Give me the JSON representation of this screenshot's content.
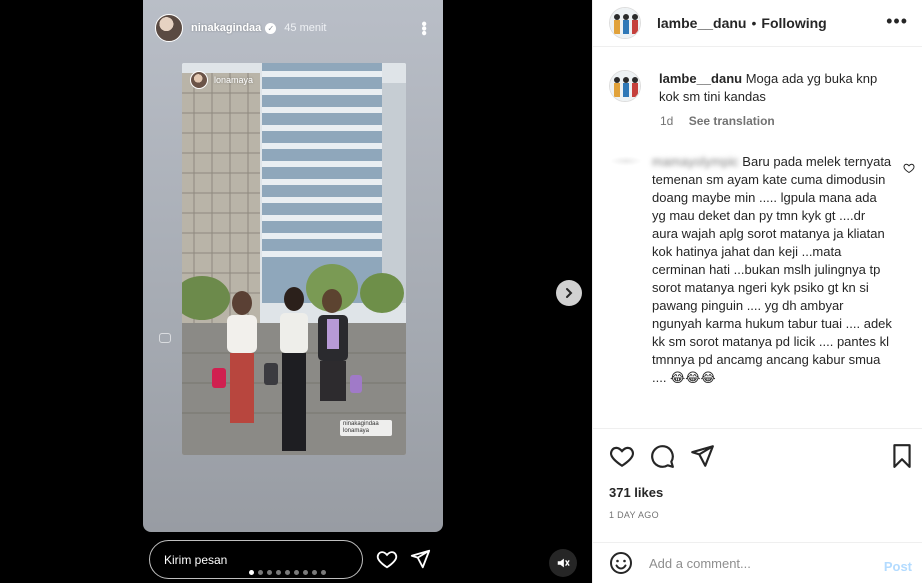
{
  "story": {
    "username": "ninakagindaa",
    "time": "45 menit",
    "inner_username": "lonamaya",
    "inner_tag": "ninakagindaa lonamaya",
    "reply_placeholder": "Kirim pesan",
    "dots_count": 9,
    "active_dot": 0
  },
  "post": {
    "header_username": "lambe__danu",
    "separator": "•",
    "follow_status": "Following",
    "caption_username": "lambe__danu",
    "caption_text": "Moga ada yg buka knp kok sm tini kandas",
    "caption_age": "1d",
    "see_translation": "See translation",
    "comment_username": "mamayolympic",
    "comment_text": " Baru pada melek ternyata temenan sm ayam kate cuma dimodusin doang maybe min ..... lgpula mana ada yg mau deket dan py tmn kyk gt ....dr aura wajah aplg sorot matanya ja kliatan kok hatinya jahat dan keji ...mata cerminan hati ...bukan mslh julingnya tp sorot matanya ngeri kyk psiko gt kn si pawang pinguin .... yg dh ambyar ngunyah karma hukum tabur tuai .... adek kk sm sorot matanya pd licik .... pantes kl tmnnya pd ancamg ancang kabur smua .... 😂😂😂",
    "likes": "371 likes",
    "date": "1 DAY AGO",
    "add_comment_placeholder": "Add a comment...",
    "post_label": "Post"
  },
  "colors": {
    "text": "#262626",
    "muted": "#737373",
    "post_disabled": "#b3dbff",
    "border": "#efefef"
  }
}
